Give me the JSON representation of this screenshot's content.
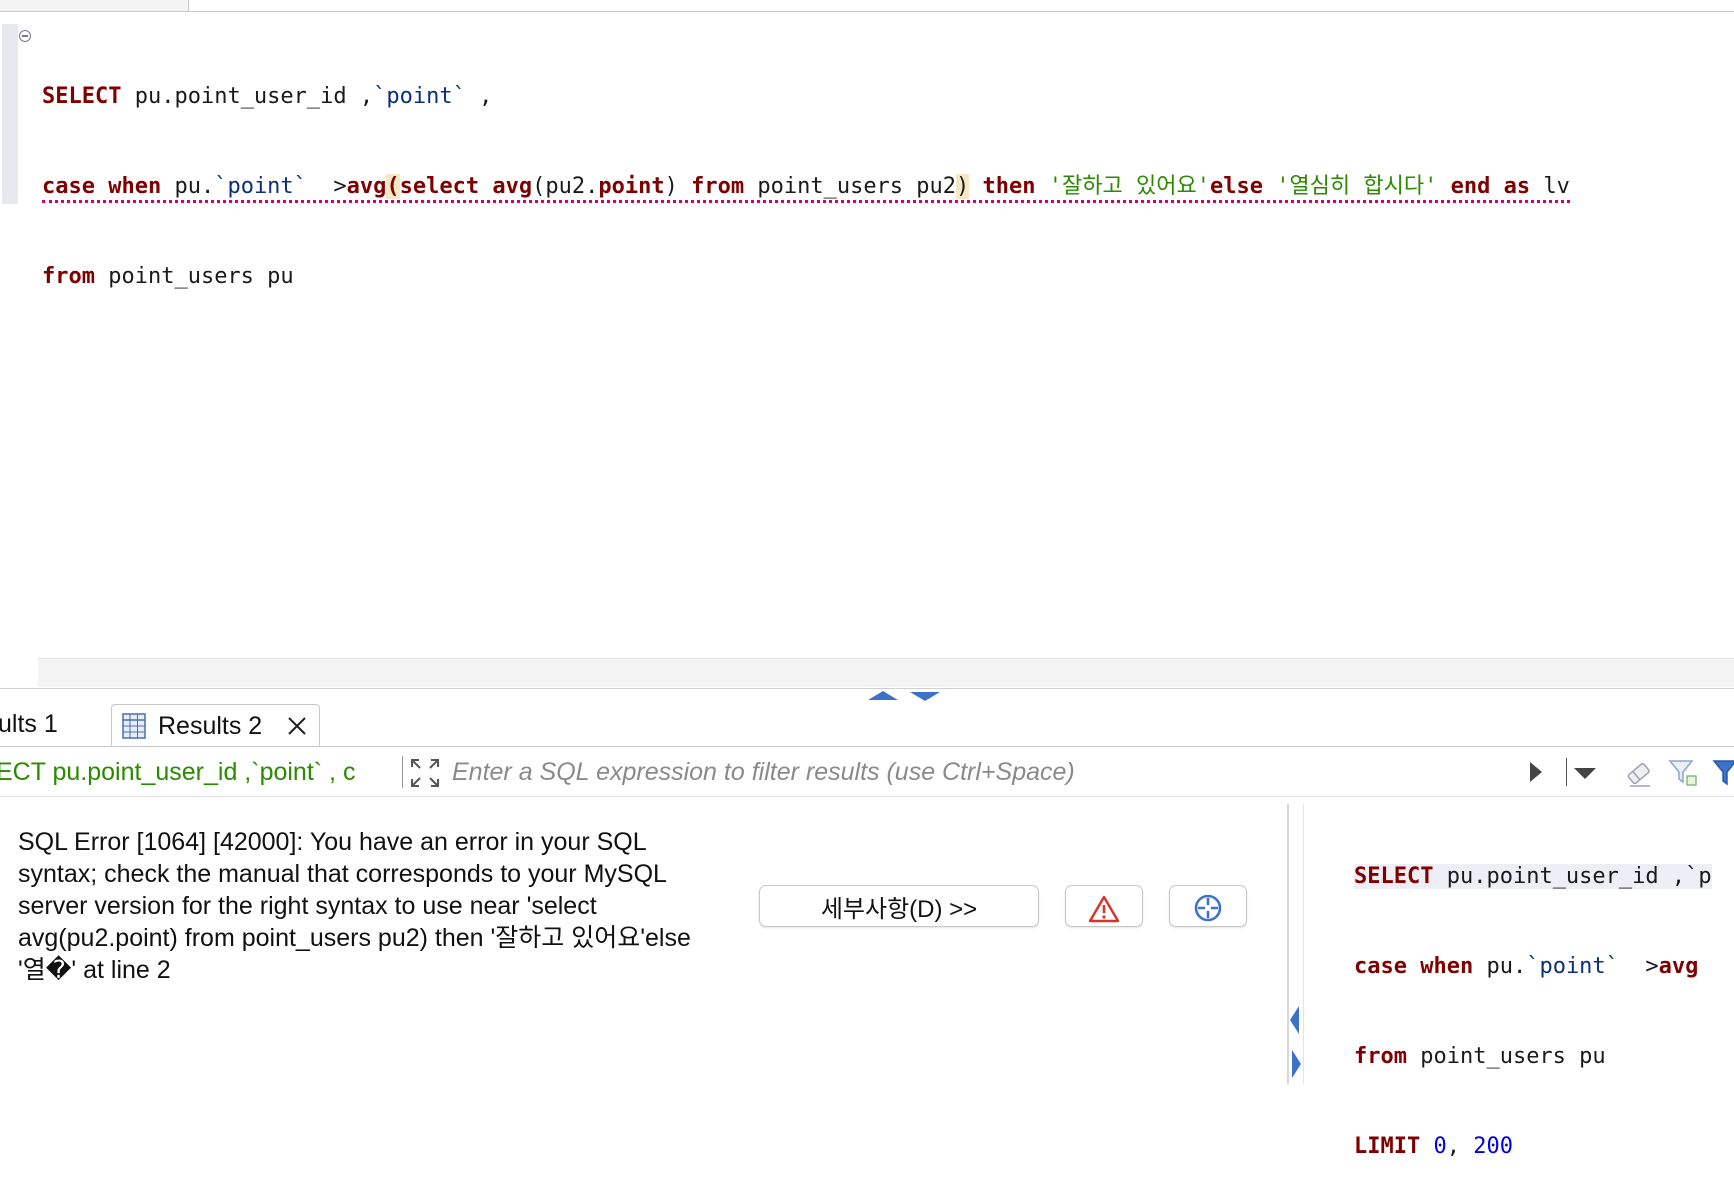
{
  "editor": {
    "line1": {
      "kw_select": "SELECT",
      "t1": " pu.point_user_id ,",
      "ident_point": "`point`",
      "t2": " ,"
    },
    "line2": {
      "kw_case": "case",
      "kw_when": "when",
      "t1": " pu.",
      "ident_point": "`point`",
      "t2": "  >",
      "kw_avg": "avg",
      "paren_open": "(",
      "kw_select": "select",
      "kw_avg2": "avg",
      "t3": "(pu2.",
      "kw_point": "point",
      "t4": ") ",
      "kw_from": "from",
      "t5": " point_users pu2",
      "paren_close": ")",
      "kw_then": "then",
      "str1": "'잘하고 있어요'",
      "kw_else": "else",
      "str2": "'열심히 합시다'",
      "kw_end": "end",
      "kw_as": "as",
      "t6": " lv"
    },
    "line3": {
      "kw_from": "from",
      "t1": " point_users pu"
    }
  },
  "tabs": [
    {
      "label": "ults 1"
    },
    {
      "label": "Results 2"
    }
  ],
  "filter": {
    "sql_snippet": "ECT pu.point_user_id ,`point` , c",
    "placeholder": "Enter a SQL expression to filter results (use Ctrl+Space)"
  },
  "error": {
    "message": "SQL Error [1064] [42000]: You have an error in your SQL syntax; check the manual that corresponds to your MySQL server version for the right syntax to use near 'select avg(pu2.point) from point_users pu2) then '잘하고 있어요'else '열�' at line 2",
    "details_button": "세부사항(D) >>"
  },
  "side_query": {
    "l1_kw": "SELECT",
    "l1_t": " pu.point_user_id ,`p",
    "l2_kw_case": "case",
    "l2_kw_when": "when",
    "l2_t": " pu.",
    "l2_ident": "`point`",
    "l2_t2": "  >",
    "l2_kw_avg": "avg",
    "l3_kw": "from",
    "l3_t": " point_users pu",
    "l4_kw": "LIMIT",
    "l4_n1": "0",
    "l4_sep": ", ",
    "l4_n2": "200"
  },
  "colors": {
    "keyword": "#7f0000",
    "identifier": "#0b2f7a",
    "string": "#2a8a00",
    "number": "#0000e6",
    "error_underline": "#d4006a",
    "accent": "#3c73c9"
  }
}
